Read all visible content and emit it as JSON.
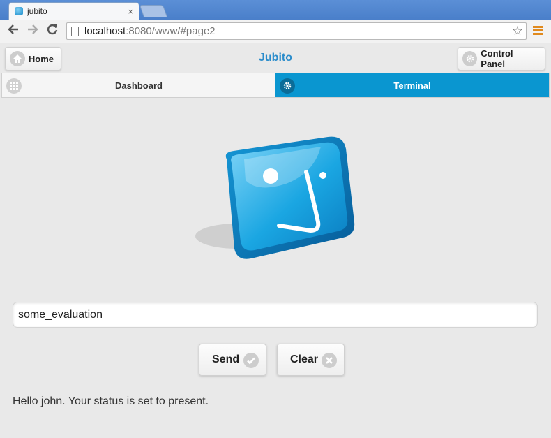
{
  "browser": {
    "tab_title": "jubito",
    "tab_close": "×",
    "url_host": "localhost",
    "url_rest": ":8080/www/#page2"
  },
  "app": {
    "title": "Jubito",
    "home_label": "Home",
    "control_panel_label": "Control Panel"
  },
  "tabs": [
    {
      "label": "Dashboard",
      "active": false
    },
    {
      "label": "Terminal",
      "active": true
    }
  ],
  "terminal": {
    "input_value": "some_evaluation",
    "send_label": "Send",
    "clear_label": "Clear",
    "status_message": "Hello john. Your status is set to present."
  },
  "colors": {
    "accent": "#0a96d0",
    "title": "#2a8ccb",
    "background": "#e9e9e9"
  },
  "icons": {
    "home": "home-icon",
    "control_panel": "gear-icon",
    "dashboard": "grid-icon",
    "terminal": "gear-icon",
    "send": "check-icon",
    "clear": "close-icon"
  }
}
